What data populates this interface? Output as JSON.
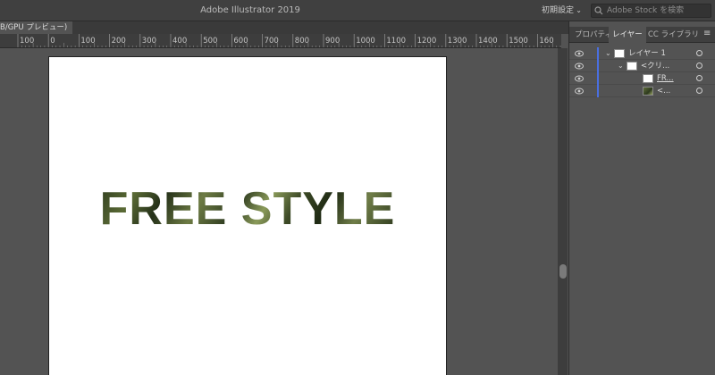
{
  "app": {
    "title": "Adobe Illustrator 2019"
  },
  "toolbar": {
    "workspace_label": "初期設定",
    "search_placeholder": "Adobe Stock を検索"
  },
  "document": {
    "tab_label": "B/GPU プレビュー)"
  },
  "ruler": {
    "labels": [
      "100",
      "0",
      "100",
      "200",
      "300",
      "400",
      "500",
      "600",
      "700",
      "800",
      "900",
      "1000",
      "1100",
      "1200",
      "1300",
      "1400",
      "1500",
      "160"
    ]
  },
  "artboard": {
    "text": "FREE STYLE"
  },
  "panel": {
    "tabs": [
      "プロパティ",
      "レイヤー",
      "CC ライブラリ"
    ],
    "active_tab": "レイヤー",
    "layers": [
      {
        "label": "レイヤー 1",
        "thumb": "white"
      },
      {
        "label": "<クリ...",
        "thumb": "white"
      },
      {
        "label": "FR...",
        "thumb": "white"
      },
      {
        "label": "<...",
        "thumb": "photo"
      }
    ]
  },
  "colors": {
    "layer_color": "#4a6fe0",
    "ui_bg": "#535353",
    "bar_bg": "#404040"
  },
  "icons": [
    "search-icon",
    "chevron-down-icon",
    "eye-icon",
    "panel-menu-icon",
    "target-icon"
  ]
}
